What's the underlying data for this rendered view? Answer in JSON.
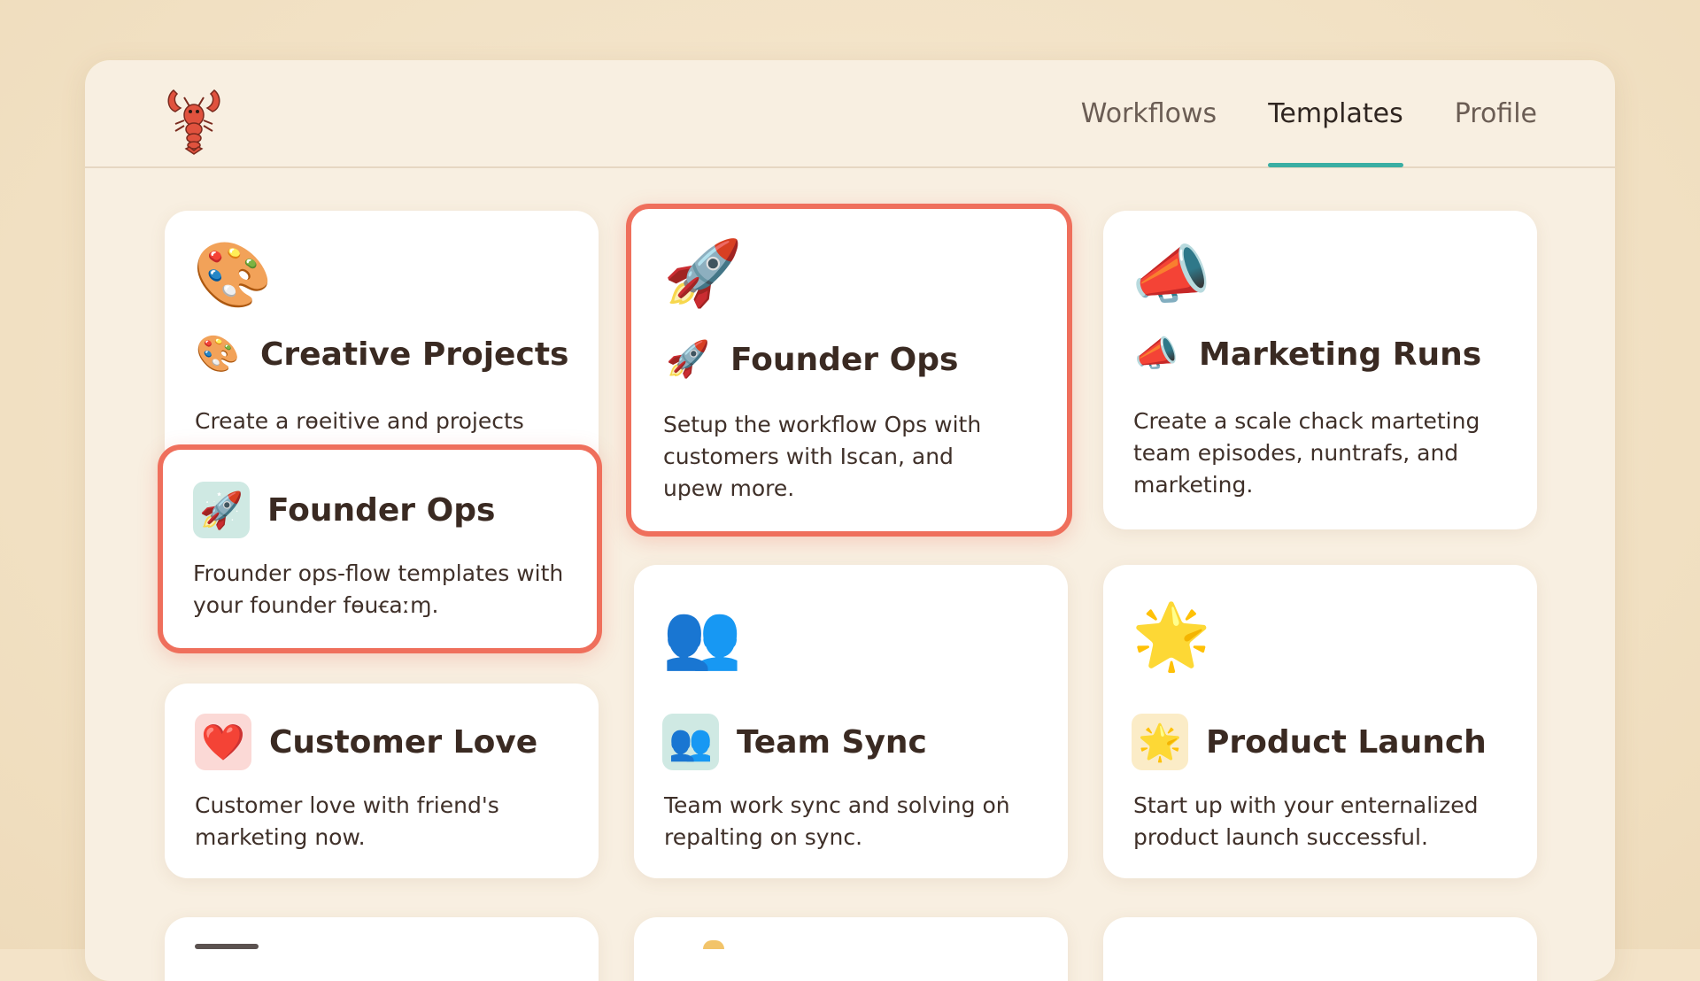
{
  "nav": {
    "tabs": [
      {
        "label": "Workflows",
        "active": false
      },
      {
        "label": "Templates",
        "active": true
      },
      {
        "label": "Profile",
        "active": false
      }
    ],
    "accent": "#3aaea3"
  },
  "highlight_color": "#ef6f5c",
  "cards": {
    "creative": {
      "icon": "palette-icon",
      "title": "Creative Projects",
      "desc": "Create a rөeitive and projects"
    },
    "founder_small": {
      "icon": "rocket-icon",
      "title": "Founder Ops",
      "desc": "Frounder ops-flow templates with your founder fөuꞓaːɱ."
    },
    "founder_main": {
      "icon": "rocket-icon",
      "title": "Founder Ops",
      "desc": "Setup the workflow Ops with customers with Iscan, and upew more."
    },
    "marketing": {
      "icon": "megaphone-icon",
      "title": "Marketing Runs",
      "desc": "Create a scale chack marteting team episodes, nuntrafs, and marketing."
    },
    "customer": {
      "icon": "heart-icon",
      "title": "Customer Love",
      "desc": "Customer love with friend's marketing now."
    },
    "team": {
      "icon": "people-icon",
      "title": "Team Sync",
      "desc": "Team work sync and solving oṅ repalting on sync."
    },
    "launch": {
      "icon": "star-icon",
      "title": "Product Launch",
      "desc": "Start up with your enternalized product launch successful."
    }
  }
}
